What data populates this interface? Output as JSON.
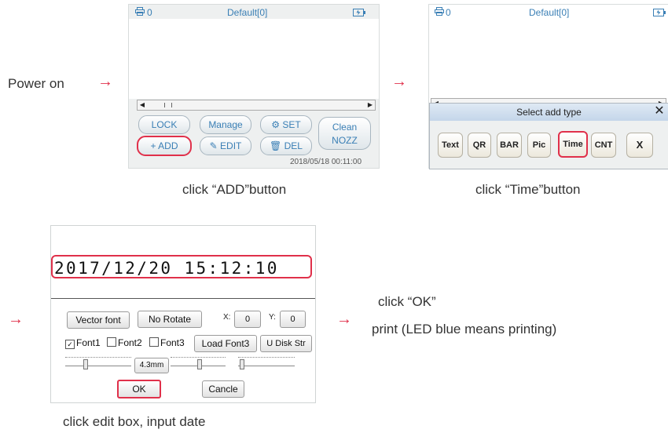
{
  "steps": {
    "power_on": "Power on",
    "click_add": "click “ADD”button",
    "click_time": "click “Time”button",
    "click_edit": "click edit box, input date",
    "click_ok": "click “OK”",
    "print_note": "print (LED blue means printing)"
  },
  "arrow_glyph": "→",
  "screen1": {
    "printer_count": "0",
    "title": "Default[0]",
    "buttons": {
      "lock": "LOCK",
      "manage": "Manage",
      "set": "SET",
      "clean_line1": "Clean",
      "clean_line2": "NOZZ",
      "add": "ADD",
      "edit": "EDIT",
      "del": "DEL"
    },
    "datetime": "2018/05/18  00:11:00"
  },
  "screen2": {
    "printer_count": "0",
    "title": "Default[0]",
    "dialog_title": "Select add type",
    "close": "✕",
    "types": [
      "Text",
      "QR",
      "BAR",
      "Pic",
      "Time",
      "CNT",
      "X"
    ]
  },
  "screen3": {
    "edit_value": "2017/12/20 15:12:10",
    "vector_font": "Vector font",
    "no_rotate": "No Rotate",
    "x_label": "X:",
    "x_value": "0",
    "y_label": "Y:",
    "y_value": "0",
    "font1": "Font1",
    "font2": "Font2",
    "font3": "Font3",
    "load_font3": "Load Font3",
    "udisk": "U Disk Str",
    "size": "4.3mm",
    "ok": "OK",
    "cancel": "Cancle"
  },
  "colors": {
    "highlight": "#e0304a",
    "accent": "#3a7fb5"
  }
}
